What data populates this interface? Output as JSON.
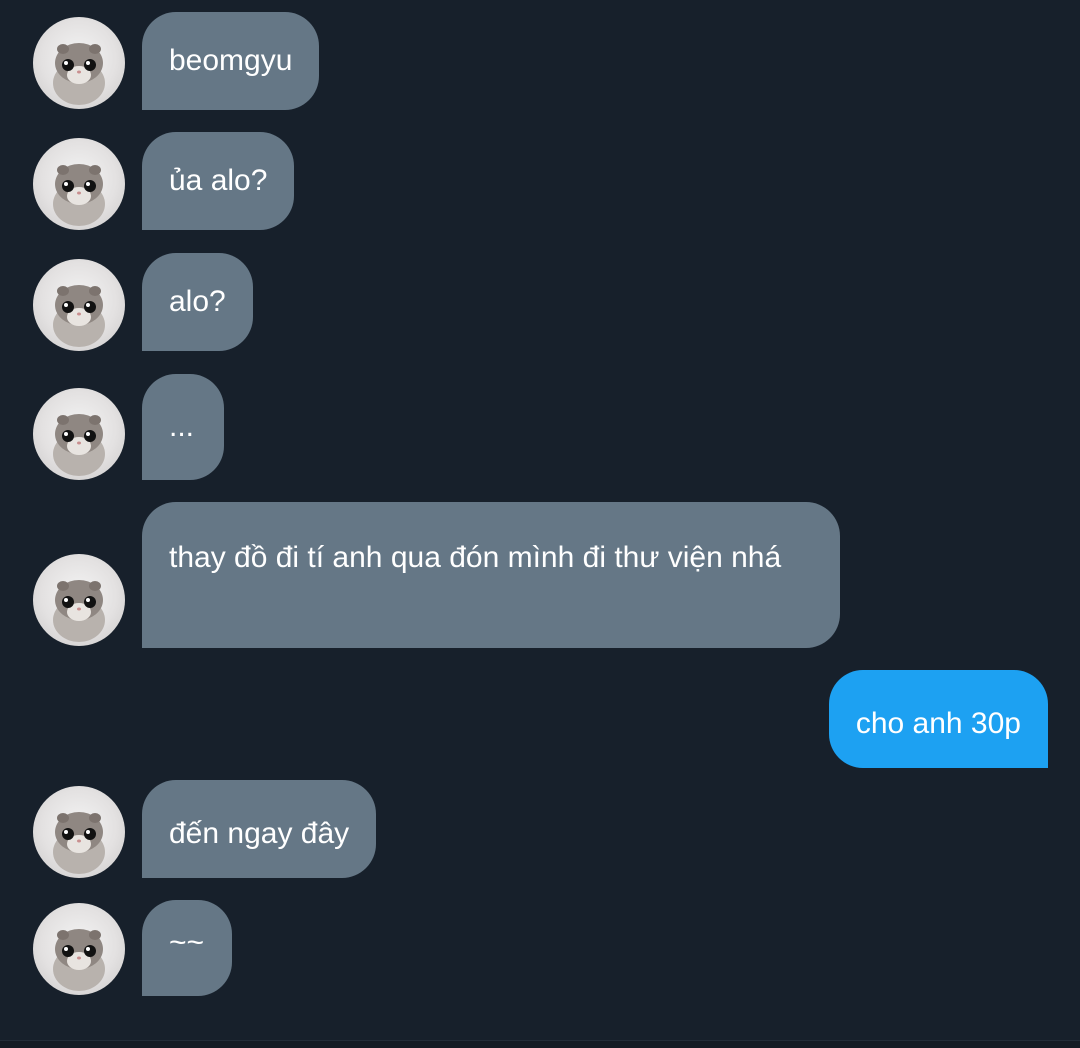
{
  "conversation": {
    "messages": [
      {
        "sender": "them",
        "text": "beomgyu"
      },
      {
        "sender": "them",
        "text": "ủa alo?"
      },
      {
        "sender": "them",
        "text": "alo?"
      },
      {
        "sender": "them",
        "text": "..."
      },
      {
        "sender": "them",
        "text": "thay đồ đi tí anh qua đón mình đi thư viện nhá"
      },
      {
        "sender": "me",
        "text": "cho anh 30p"
      },
      {
        "sender": "them",
        "text": "đến ngay đây"
      },
      {
        "sender": "them",
        "text": "~~"
      }
    ]
  },
  "colors": {
    "background": "#17202b",
    "incoming_bubble": "#657786",
    "outgoing_bubble": "#1da1f2",
    "text": "#ffffff"
  },
  "icons": {
    "avatar": "hamster-avatar-icon"
  }
}
